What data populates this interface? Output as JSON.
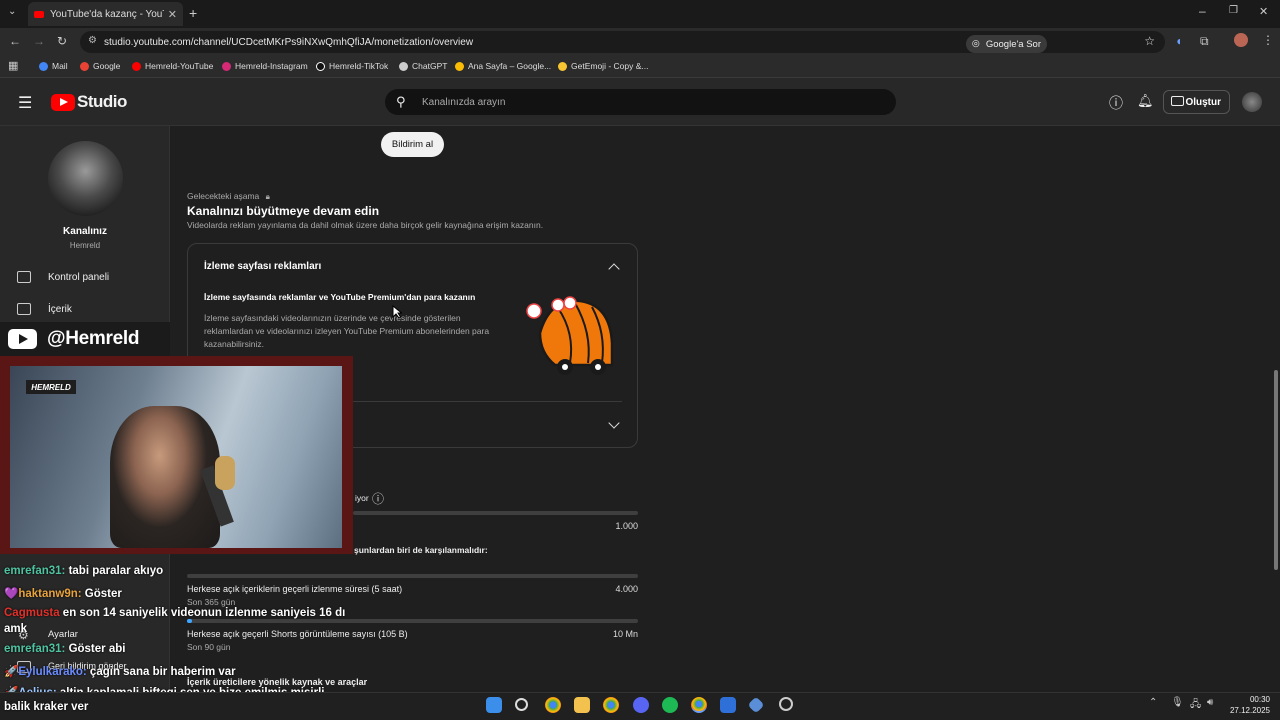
{
  "browser": {
    "tab_title": "YouTube'da kazanç - YouTube S",
    "url": "studio.youtube.com/channel/UCDcetMKrPs9iNXwQmhQfiJA/monetization/overview",
    "google_sor": "Google'a Sor",
    "bookmarks": [
      {
        "label": "Mail",
        "color": "#4285f4"
      },
      {
        "label": "Google",
        "color": "#ea4335"
      },
      {
        "label": "Hemreld-YouTube",
        "color": "#ff0000"
      },
      {
        "label": "Hemreld-Instagram",
        "color": "#d62976"
      },
      {
        "label": "Hemreld-TikTok",
        "color": "#ffffff"
      },
      {
        "label": "ChatGPT",
        "color": "#cccccc"
      },
      {
        "label": "Ana Sayfa – Google...",
        "color": "#fbbc05"
      },
      {
        "label": "GetEmoji - Copy &...",
        "color": "#f7c531"
      }
    ]
  },
  "studio": {
    "logo_text": "Studio",
    "search_placeholder": "Kanalınızda arayın",
    "create_label": "Oluştur"
  },
  "sidebar": {
    "channel_name": "Kanalınız",
    "channel_handle": "Hemreld",
    "items": [
      {
        "label": "Kontrol paneli"
      },
      {
        "label": "İçerik"
      },
      {
        "label": "Ayarlar"
      },
      {
        "label": "Geri bildirim gönder"
      }
    ]
  },
  "main": {
    "notify_button": "Bildirim al",
    "stage_label": "Gelecekteki aşama",
    "grow_title": "Kanalınızı büyütmeye devam edin",
    "grow_desc": "Videolarda reklam yayınlama da dahil olmak üzere daha birçok gelir kaynağına erişim kazanın.",
    "card_title": "İzleme sayfası reklamları",
    "card_subtitle": "İzleme sayfasında reklamlar ve YouTube Premium'dan para kazanın",
    "card_desc": "İzleme sayfasındaki videolarınızın üzerinde ve çevresinde gösterilen reklamlardan ve videolarınızı izleyen YouTube Premium abonelerinden para kazanabilirsiniz.",
    "req_partial": "iyor",
    "req_value_top": "1.000",
    "req_condition": "şunlardan biri de karşılanmalıdır:",
    "requirements": [
      {
        "label": "Herkese açık içeriklerin geçerli izlenme süresi (5 saat)",
        "sub": "Son 365 gün",
        "target": "4.000",
        "progress": 0.0
      },
      {
        "label": "Herkese açık geçerli Shorts görüntüleme sayısı (105 B)",
        "sub": "Son 90 gün",
        "target": "10 Mn",
        "progress": 0.01
      }
    ],
    "footer_text": "İçerik üreticilere yönelik kaynak ve araçlar"
  },
  "stream": {
    "handle": "@Hemreld",
    "webcam_logo": "HEMRELD",
    "chat": [
      {
        "user": "emrefan31:",
        "msg": " tabi paralar akıyo",
        "color": "#4fc3a1",
        "prefix": ""
      },
      {
        "user": "haktanw9n:",
        "msg": " Göster",
        "color": "#e8a33d",
        "prefix": "💜"
      },
      {
        "user": "Cagmusta",
        "msg": " en son 14 saniyelik videonun izlenme saniyeis 16 dı",
        "color": "#e0312b",
        "prefix": ""
      },
      {
        "user": "",
        "msg": "amk",
        "color": "#ffffff",
        "prefix": ""
      },
      {
        "user": "emrefan31:",
        "msg": " Göster abi",
        "color": "#4fc3a1",
        "prefix": ""
      },
      {
        "user": "Eylulkarako:",
        "msg": " çagin sana bir haberim var",
        "color": "#6b8cff",
        "prefix": "🚀"
      },
      {
        "user": "Aelius:",
        "msg": " altin kaplamali biftegi sen ye bize emilmiş misirli",
        "color": "#9bc6ff",
        "prefix": "🚀"
      },
      {
        "user": "",
        "msg": "balik kraker ver",
        "color": "#ffffff",
        "prefix": ""
      }
    ]
  },
  "taskbar": {
    "time": "00:30",
    "date": "27.12.2025"
  }
}
